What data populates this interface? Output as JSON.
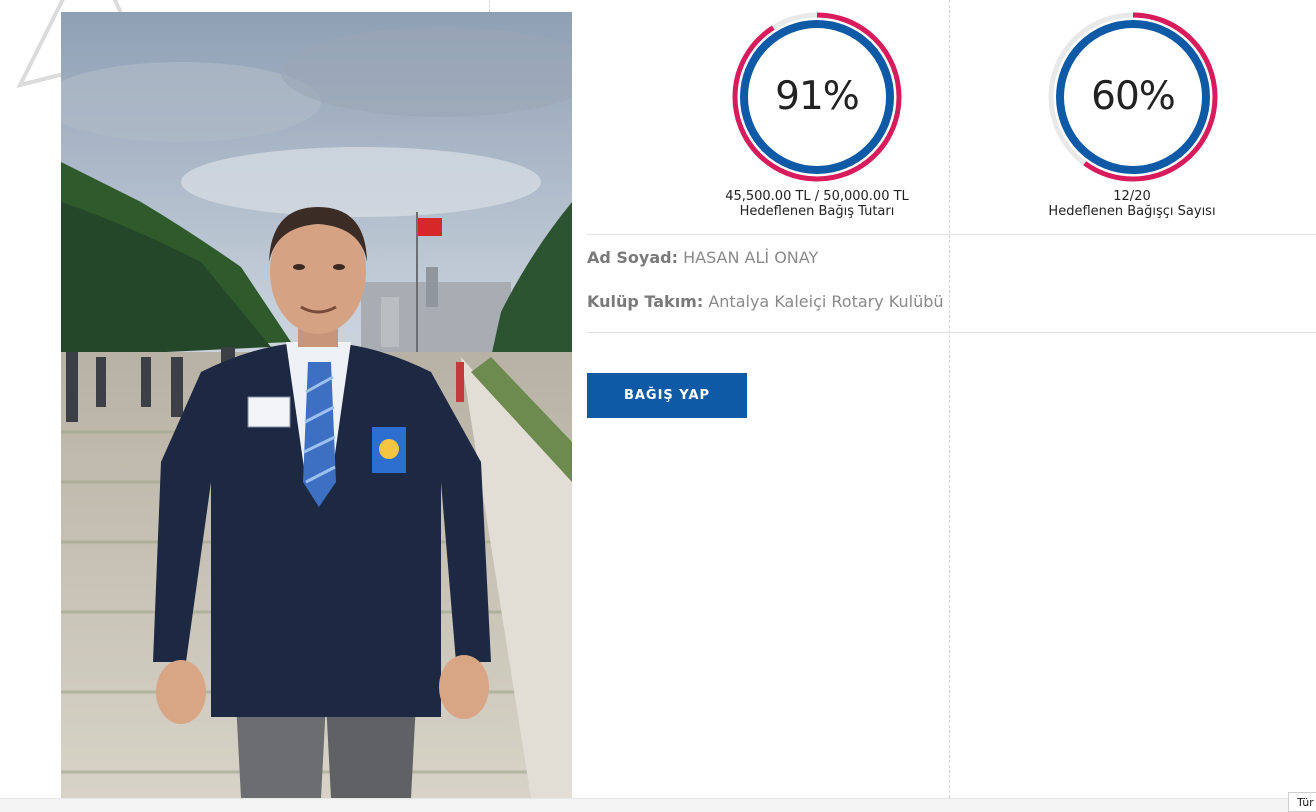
{
  "stats": [
    {
      "percent_label": "91%",
      "progress": 0.91,
      "value_text": "45,500.00 TL / 50,000.00 TL",
      "caption": "Hedeflenen Bağış Tutarı"
    },
    {
      "percent_label": "60%",
      "progress": 0.6,
      "value_text": "12/20",
      "caption": "Hedeflenen Bağışçı Sayısı"
    }
  ],
  "profile": {
    "name_label": "Ad Soyad:",
    "name_value": "HASAN ALİ ONAY",
    "club_label": "Kulüp Takım:",
    "club_value": "Antalya Kaleiçi Rotary Kulübü"
  },
  "donate_button": {
    "label": "BAĞIŞ YAP"
  },
  "language_tab": {
    "label": "Tür"
  },
  "colors": {
    "ring_outer": "#d81b5a",
    "ring_inner": "#0f5aa7",
    "button_bg": "#0f5aa7"
  }
}
